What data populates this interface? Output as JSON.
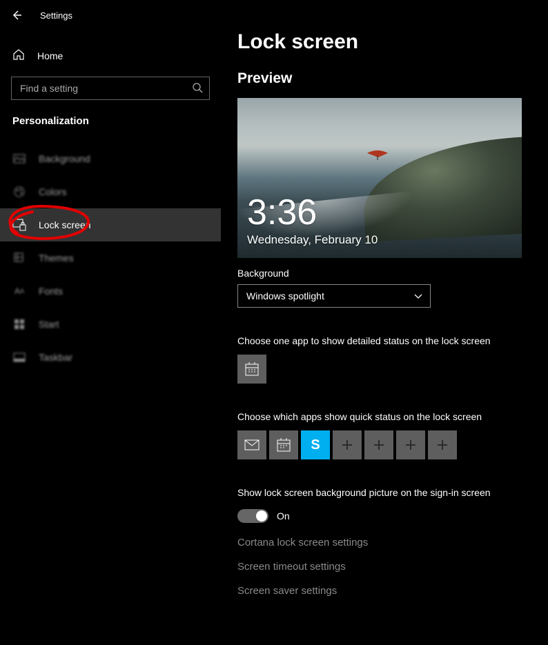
{
  "header": {
    "app_title": "Settings"
  },
  "sidebar": {
    "home_label": "Home",
    "search_placeholder": "Find a setting",
    "section_title": "Personalization",
    "items": [
      {
        "label": "Background"
      },
      {
        "label": "Colors"
      },
      {
        "label": "Lock screen"
      },
      {
        "label": "Themes"
      },
      {
        "label": "Fonts"
      },
      {
        "label": "Start"
      },
      {
        "label": "Taskbar"
      }
    ]
  },
  "main": {
    "page_title": "Lock screen",
    "preview_heading": "Preview",
    "preview_time": "3:36",
    "preview_date": "Wednesday, February 10",
    "background_label": "Background",
    "background_dropdown_value": "Windows spotlight",
    "detailed_heading": "Choose one app to show detailed status on the lock screen",
    "detailed_apps": [
      "calendar-icon"
    ],
    "quick_heading": "Choose which apps show quick status on the lock screen",
    "quick_apps": [
      "mail-icon",
      "calendar-icon",
      "skype-icon",
      "plus-icon",
      "plus-icon",
      "plus-icon",
      "plus-icon"
    ],
    "toggle_label": "Show lock screen background picture on the sign-in screen",
    "toggle_state_text": "On",
    "links": [
      "Cortana lock screen settings",
      "Screen timeout settings",
      "Screen saver settings"
    ]
  }
}
